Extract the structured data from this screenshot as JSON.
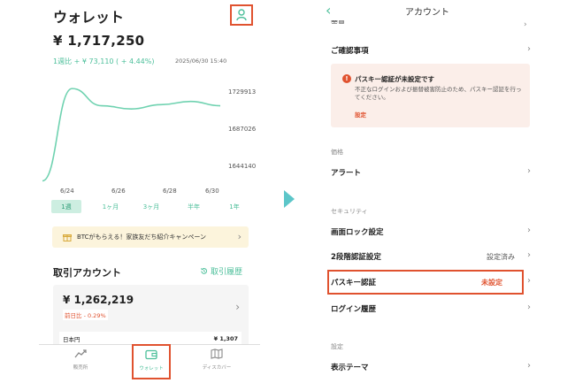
{
  "left": {
    "title": "ウォレット",
    "balance": "¥ 1,717,250",
    "change": "1週比 + ¥ 73,110 ( + 4.44%)",
    "as_of": "2025/06/30 15:40",
    "y_labels": [
      "1729913",
      "1687026",
      "1644140"
    ],
    "x_labels": [
      "6/24",
      "6/26",
      "6/28",
      "6/30"
    ],
    "periods": [
      "1週",
      "1ヶ月",
      "3ヶ月",
      "半年",
      "1年"
    ],
    "campaign": "BTCがもらえる！家族友だち紹介キャンペーン",
    "account_title": "取引アカウント",
    "history_link": "取引履歴",
    "account_amount": "¥ 1,262,219",
    "account_change": "前日比 - 0.29%",
    "jpy_label": "日本円",
    "jpy_value": "¥ 1,307",
    "tabs": [
      "販売所",
      "ウォレット",
      "ディスカバー"
    ]
  },
  "chart_data": {
    "type": "line",
    "x": [
      "6/24",
      "6/25",
      "6/26",
      "6/27",
      "6/28",
      "6/29",
      "6/30"
    ],
    "values": [
      1642000,
      1728000,
      1712000,
      1709000,
      1713000,
      1716000,
      1712000
    ],
    "ylim": [
      1635000,
      1738000
    ],
    "color": "#6fd2b0",
    "grid": false
  },
  "right": {
    "title": "アカウント",
    "cutoff_item": "基督",
    "confirm": "ご確認事項",
    "alert_title": "パスキー認証が未設定です",
    "alert_body": "不正なログインおよび振替被害防止のため、パスキー認証を行ってください。",
    "alert_link": "設定",
    "section_price": "価格",
    "alert_item": "アラート",
    "section_security": "セキュリティ",
    "screen_lock": "画面ロック設定",
    "two_factor": "2段階認証設定",
    "two_factor_status": "設定済み",
    "passkey": "パスキー認証",
    "passkey_status": "未設定",
    "login_history": "ログイン履歴",
    "section_settings": "設定",
    "theme": "表示テーマ"
  },
  "colors": {
    "accent": "#4cbf9a",
    "highlight": "#e0522f",
    "arrow": "#5cc6c9"
  }
}
